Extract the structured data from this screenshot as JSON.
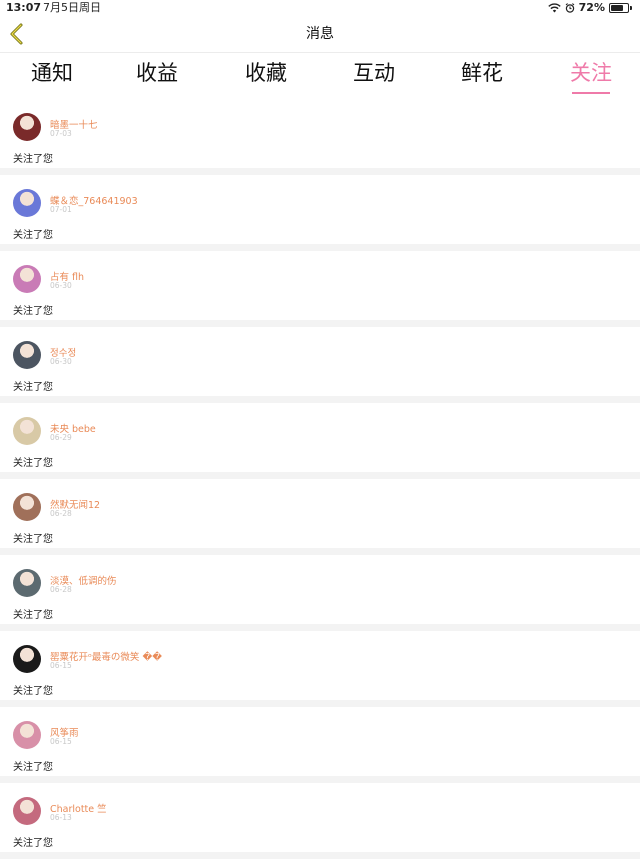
{
  "status_bar": {
    "time": "13:07",
    "date": "7月5日周日",
    "battery": "72%",
    "battery_level": 0.72
  },
  "nav": {
    "title": "消息",
    "back_icon": "chevron-left-icon"
  },
  "tabs": [
    {
      "label": "通知",
      "active": false
    },
    {
      "label": "收益",
      "active": false
    },
    {
      "label": "收藏",
      "active": false
    },
    {
      "label": "互动",
      "active": false
    },
    {
      "label": "鲜花",
      "active": false
    },
    {
      "label": "关注",
      "active": true
    }
  ],
  "colors": {
    "accent": "#ef7aa9",
    "username": "#e98a57",
    "date": "#c8c8c8"
  },
  "items": [
    {
      "name": "暗墨一十七",
      "date": "07-03",
      "message": "关注了您",
      "avatar_color": "#7a2a2a"
    },
    {
      "name": "蝶＆恋_764641903",
      "date": "07-01",
      "message": "关注了您",
      "avatar_color": "#6a78d8"
    },
    {
      "name": "占有 flh",
      "date": "06-30",
      "message": "关注了您",
      "avatar_color": "#c97bb6"
    },
    {
      "name": "정수정",
      "date": "06-30",
      "message": "关注了您",
      "avatar_color": "#4c5561"
    },
    {
      "name": "未央 bebe",
      "date": "06-29",
      "message": "关注了您",
      "avatar_color": "#d8c9a6"
    },
    {
      "name": "然默无闻12",
      "date": "06-28",
      "message": "关注了您",
      "avatar_color": "#a0705a"
    },
    {
      "name": "淡漠、低调的伤",
      "date": "06-28",
      "message": "关注了您",
      "avatar_color": "#5c6a70"
    },
    {
      "name": "罂粟花开ᵒ最毒の微笑 ��",
      "date": "06-15",
      "message": "关注了您",
      "avatar_color": "#1a1a1a"
    },
    {
      "name": "风筝雨",
      "date": "06-15",
      "message": "关注了您",
      "avatar_color": "#d890a8"
    },
    {
      "name": "Charlotte 竺",
      "date": "06-13",
      "message": "关注了您",
      "avatar_color": "#c46a7e"
    }
  ]
}
